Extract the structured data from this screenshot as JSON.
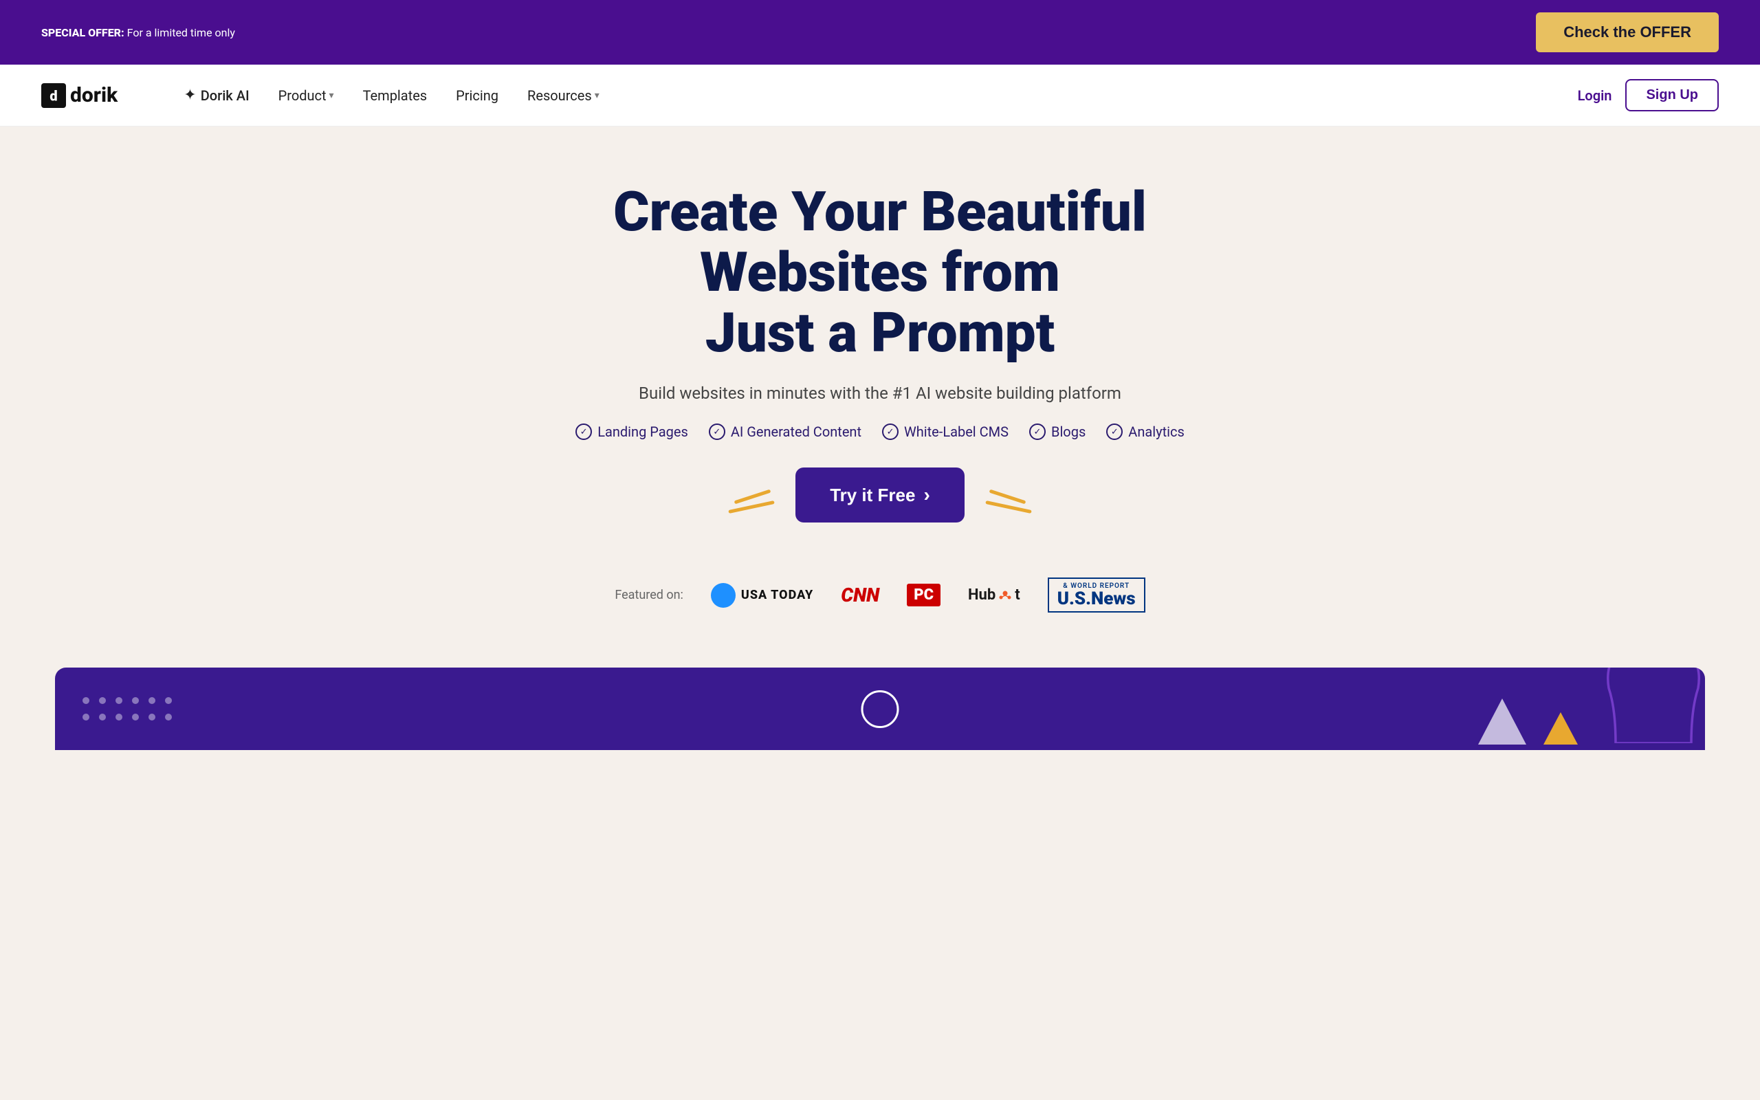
{
  "banner": {
    "special_offer_bold": "SPECIAL OFFER:",
    "special_offer_text": " For a limited time only",
    "cta_label": "Check the OFFER"
  },
  "nav": {
    "logo_text": "dorik",
    "ai_label": "Dorik AI",
    "product_label": "Product",
    "templates_label": "Templates",
    "pricing_label": "Pricing",
    "resources_label": "Resources",
    "login_label": "Login",
    "signup_label": "Sign Up"
  },
  "hero": {
    "title_line1": "Create Your Beautiful Websites from",
    "title_line2": "Just a Prompt",
    "subtitle": "Build websites in minutes with the #1 AI website building platform",
    "features": [
      "Landing Pages",
      "AI Generated Content",
      "White-Label CMS",
      "Blogs",
      "Analytics"
    ],
    "cta_label": "Try it Free",
    "cta_arrow": "›"
  },
  "featured": {
    "label": "Featured on:",
    "logos": [
      "USA TODAY",
      "CNN",
      "PC",
      "HubSpot",
      "U.S.News"
    ]
  }
}
